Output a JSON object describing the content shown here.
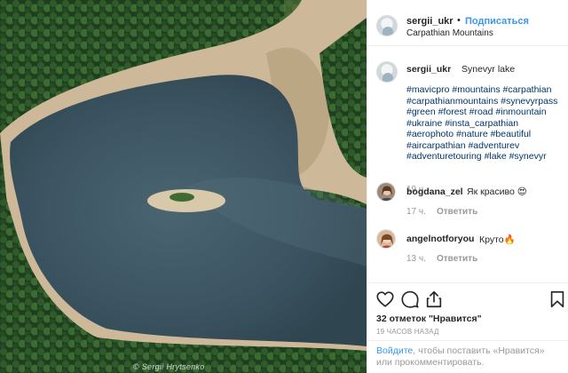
{
  "post": {
    "username": "sergii_ukr",
    "separator": "•",
    "follow_label": "Подписаться",
    "location": "Carpathian Mountains",
    "photo_watermark": "© Sergii Hrytsenko"
  },
  "caption": {
    "username": "sergii_ukr",
    "text": "Synevyr lake",
    "hashtags": [
      "#mavicpro",
      "#mountains",
      "#carpathian",
      "#carpathianmountains",
      "#synevyrpass",
      "#green",
      "#forest",
      "#road",
      "#inmountain",
      "#ukraine",
      "#insta_carpathian",
      "#aerophoto",
      "#nature",
      "#beautiful",
      "#aircarpathian",
      "#adventurev",
      "#adventuretouring",
      "#lake",
      "#synevyr"
    ],
    "hashtag_lines": [
      "#mavicpro #mountains #carpathian",
      "#carpathianmountains #synevyrpass",
      "#green #forest #road #inmountain",
      "#ukraine #insta_carpathian",
      "#aerophoto #nature #beautiful",
      "#aircarpathian #adventurev",
      "#adventuretouring #lake #synevyr"
    ],
    "time": "19 ч."
  },
  "comments": [
    {
      "username": "bogdana_zel",
      "text": "Як красиво 😍",
      "time": "17 ч.",
      "reply_label": "Ответить"
    },
    {
      "username": "angelnotforyou",
      "text": "Круто🔥",
      "time": "13 ч.",
      "reply_label": "Ответить"
    }
  ],
  "actions": {
    "like_icon": "heart-icon",
    "comment_icon": "comment-bubble-icon",
    "share_icon": "share-icon",
    "save_icon": "bookmark-icon",
    "likes_text": "32 отметок \"Нравится\"",
    "posted_time": "19 часов назад"
  },
  "login_prompt": {
    "link": "Войдите",
    "text": ", чтобы поставить «Нравится» или прокомментировать."
  }
}
